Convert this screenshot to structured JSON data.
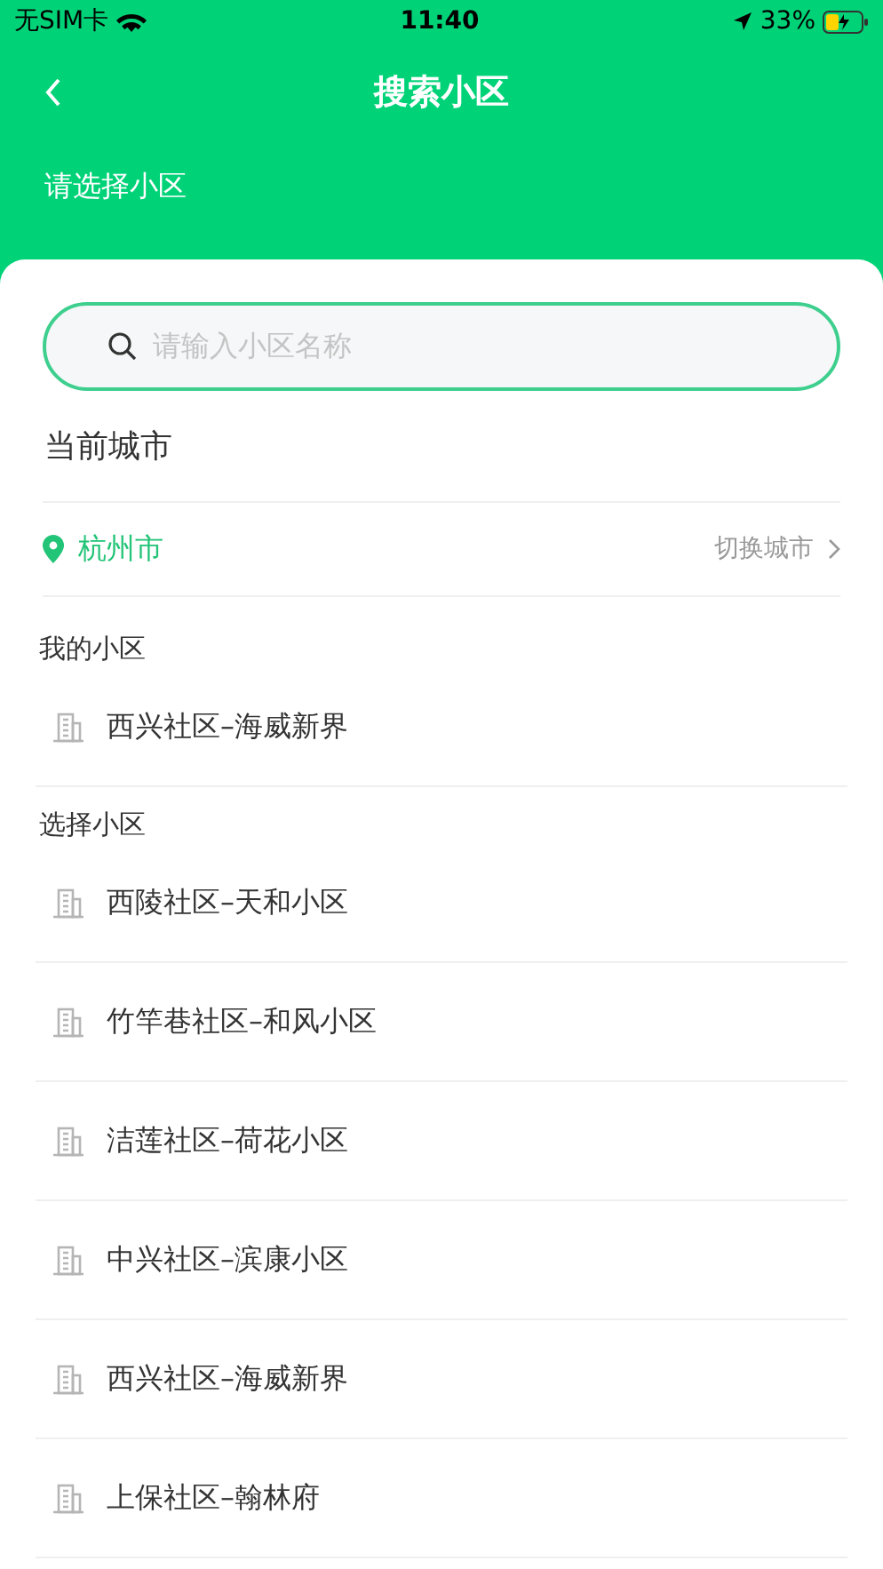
{
  "status_bar": {
    "carrier": "无SIM卡",
    "time": "11:40",
    "battery": "33%"
  },
  "nav": {
    "title": "搜索小区"
  },
  "subtitle": "请选择小区",
  "search": {
    "placeholder": "请输入小区名称"
  },
  "current_city": {
    "heading": "当前城市",
    "city": "杭州市",
    "switch": "切换城市"
  },
  "my_communities": {
    "heading": "我的小区",
    "items": [
      "西兴社区–海威新界"
    ]
  },
  "choose_communities": {
    "heading": "选择小区",
    "items": [
      "西陵社区–天和小区",
      "竹竿巷社区–和风小区",
      "洁莲社区–荷花小区",
      "中兴社区–滨康小区",
      "西兴社区–海威新界",
      "上保社区–翰林府"
    ]
  }
}
